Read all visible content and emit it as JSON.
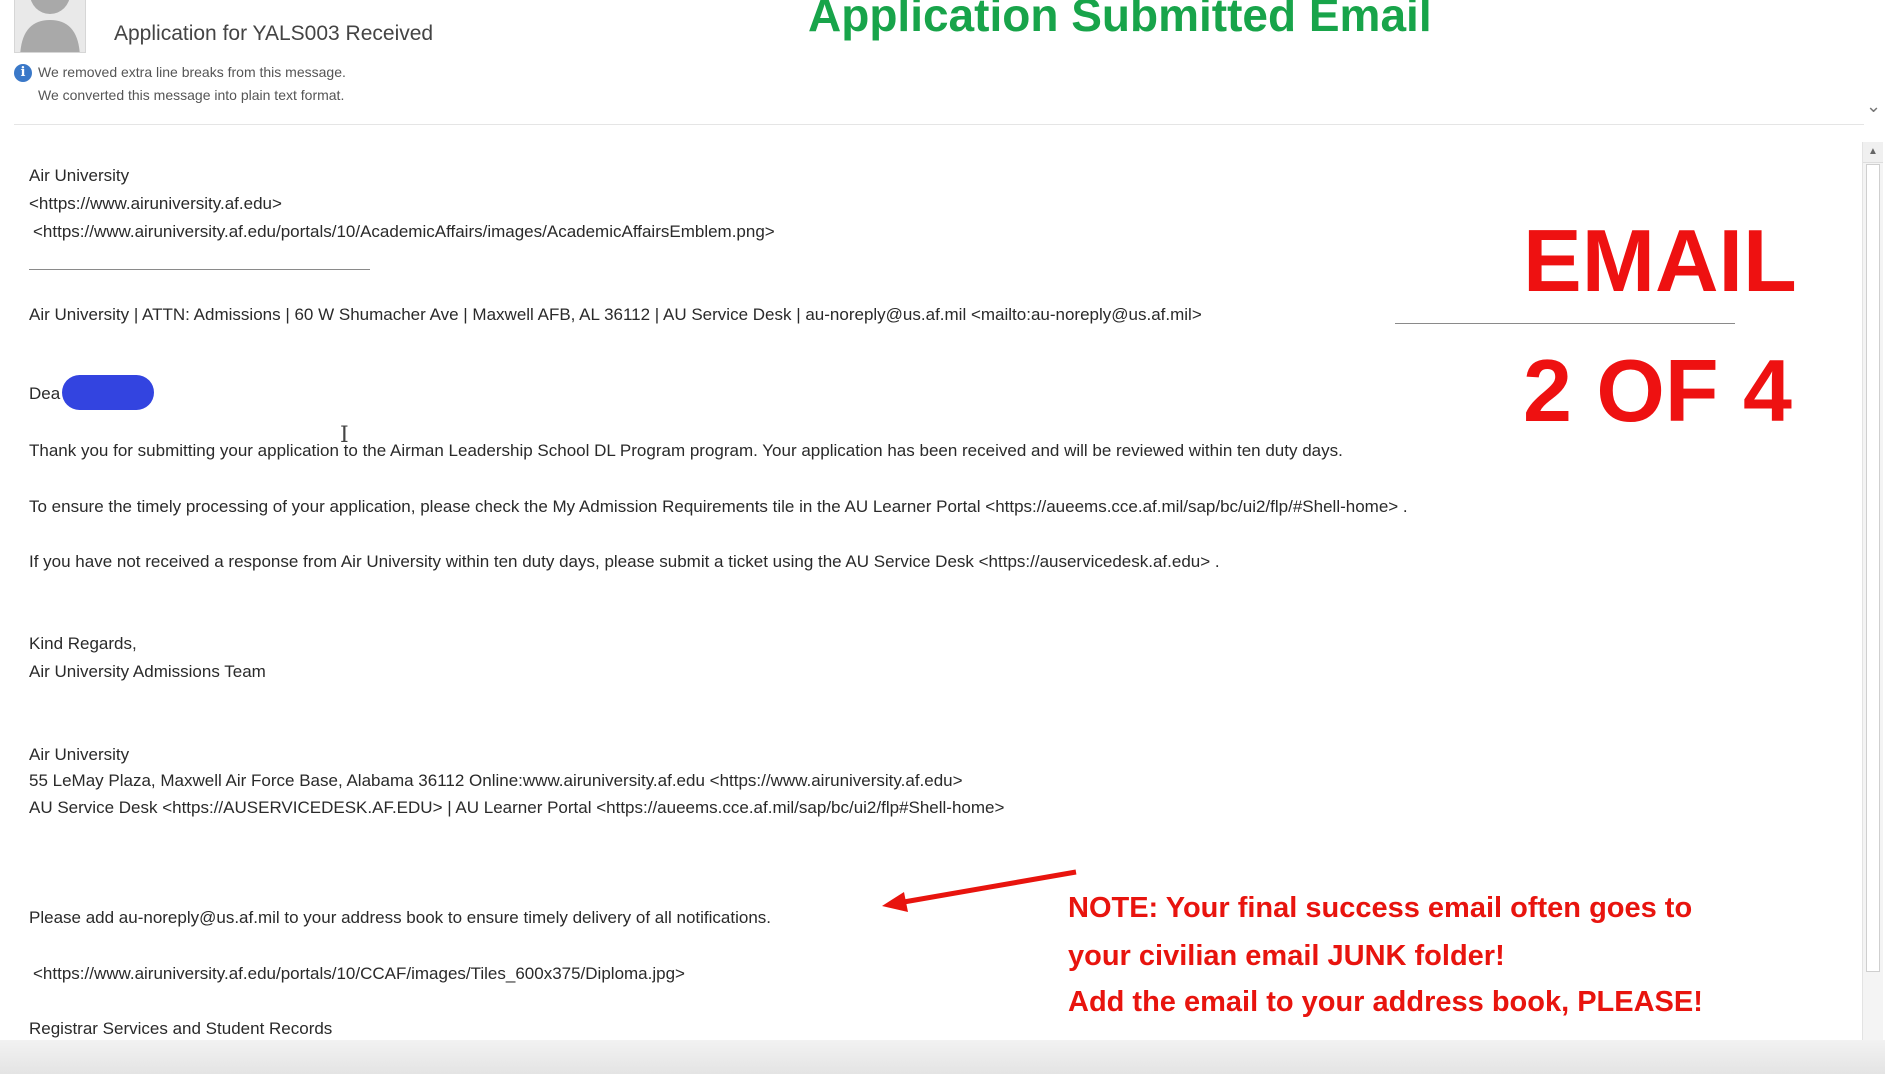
{
  "header": {
    "subject": "Application for YALS003 Received",
    "info_line1": "We removed extra line breaks from this message.",
    "info_line2": "We converted this message into plain text format.",
    "info_icon_glyph": "i",
    "expand_glyph": "⌄"
  },
  "overlay": {
    "title": "Application Submitted Email",
    "big_line1": "EMAIL",
    "big_line2": "2 OF 4",
    "note_line1": "NOTE:  Your final success email often goes to",
    "note_line2": "your civilian email JUNK folder!",
    "note_line3": "Add the email to your address book, PLEASE!",
    "title_color": "#18a44a",
    "note_color": "#e8140e"
  },
  "email": {
    "org_name": "Air University",
    "org_link": "<https://www.airuniversity.af.edu>",
    "emblem_link": "<https://www.airuniversity.af.edu/portals/10/AcademicAffairs/images/AcademicAffairsEmblem.png>",
    "address_line": "Air University | ATTN: Admissions | 60 W Shumacher Ave | Maxwell AFB, AL 36112 | AU Service Desk | au-noreply@us.af.mil <mailto:au-noreply@us.af.mil>",
    "greeting": "Dea",
    "para1": "Thank you for submitting your application to the Airman Leadership School DL Program program. Your application has been received and will be reviewed within ten duty days.",
    "para2": "To ensure the timely processing of your application, please check the My Admission Requirements tile in the AU Learner Portal <https://aueems.cce.af.mil/sap/bc/ui2/flp/#Shell-home> .",
    "para3": "If you have not received a response from Air University within ten duty days, please submit a ticket using the AU Service Desk <https://auservicedesk.af.edu> .",
    "closing": "Kind Regards,",
    "signature": "Air University Admissions Team",
    "footer_org": "Air University",
    "footer_address": "55 LeMay Plaza, Maxwell Air Force Base, Alabama 36112 Online:www.airuniversity.af.edu <https://www.airuniversity.af.edu>",
    "footer_links": "AU Service Desk <https://AUSERVICEDESK.AF.EDU> | AU Learner Portal <https://aueems.cce.af.mil/sap/bc/ui2/flp#Shell-home>",
    "address_book": "Please add au-noreply@us.af.mil to your address book to ensure timely delivery of all notifications.",
    "diploma_link": "<https://www.airuniversity.af.edu/portals/10/CCAF/images/Tiles_600x375/Diploma.jpg>",
    "registrar": "Registrar Services and Student Records"
  },
  "scrollbar": {
    "up_glyph": "▲"
  }
}
